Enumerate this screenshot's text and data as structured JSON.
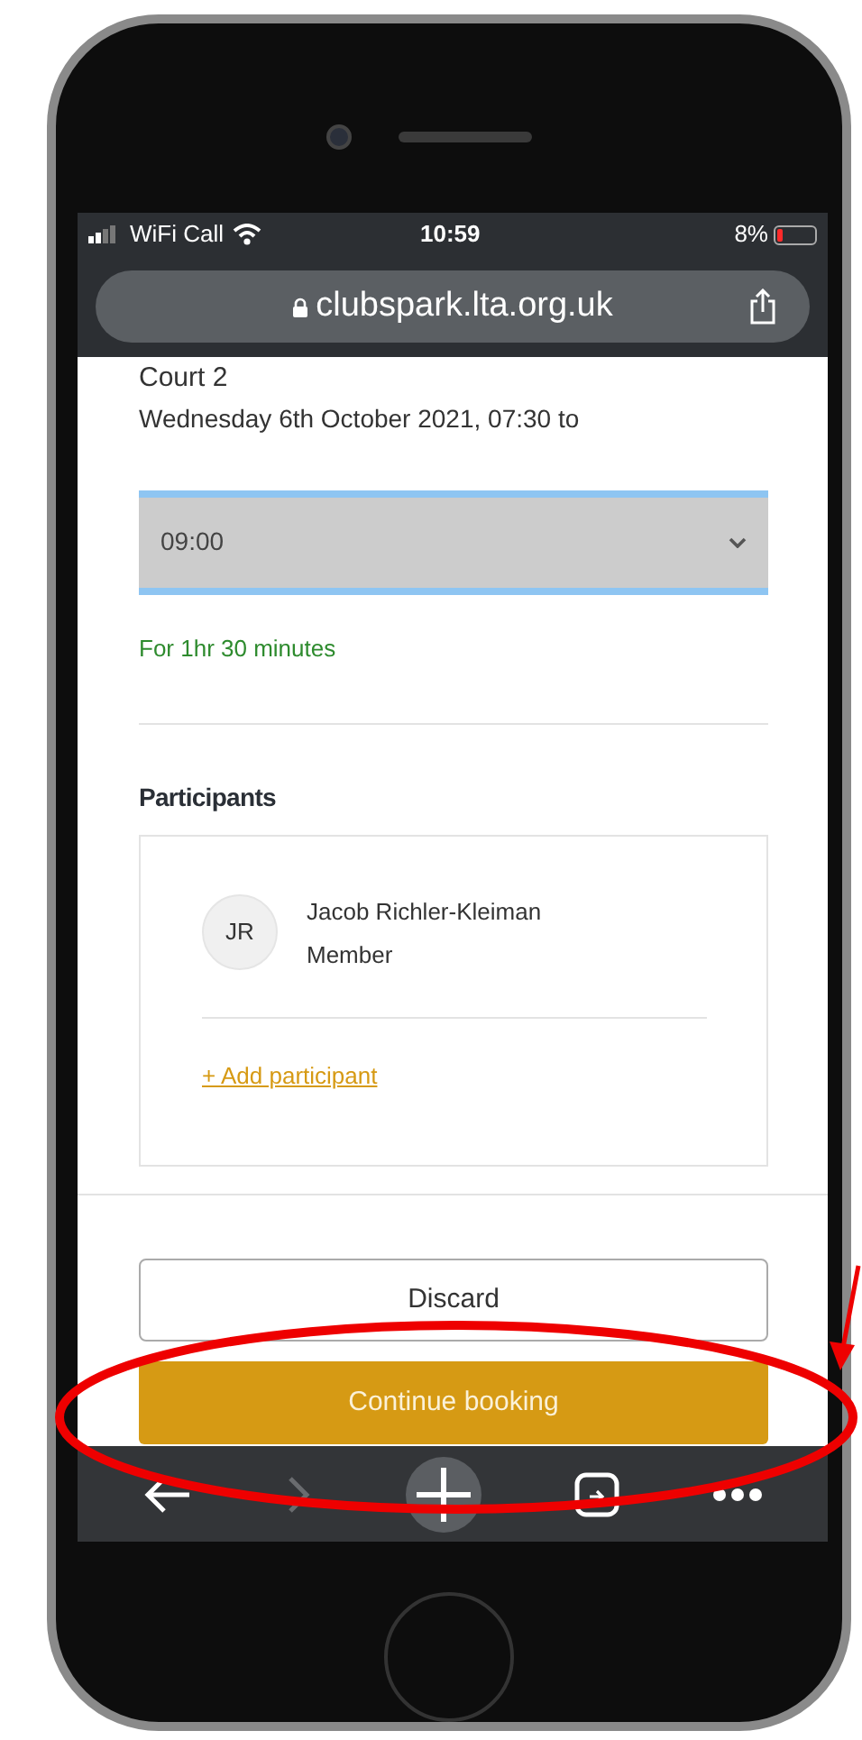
{
  "status_bar": {
    "carrier": "WiFi Call",
    "time": "10:59",
    "battery": "8%"
  },
  "address_bar": {
    "url": "clubspark.lta.org.uk"
  },
  "booking": {
    "court": "Court 2",
    "date_line": "Wednesday 6th October 2021, 07:30 to",
    "end_time": "09:00",
    "duration": "For 1hr 30 minutes"
  },
  "participants": {
    "heading": "Participants",
    "list": [
      {
        "initials": "JR",
        "name": "Jacob Richler-Kleiman",
        "role": "Member"
      }
    ],
    "add_link": "+ Add participant"
  },
  "buttons": [
    {
      "label": "Discard",
      "kind": "outline"
    },
    {
      "label": "Continue booking",
      "kind": "primary"
    }
  ],
  "toolbar": [
    {
      "kind": "back",
      "disabled": false
    },
    {
      "kind": "forward",
      "disabled": true
    },
    {
      "kind": "new-tab",
      "disabled": false
    },
    {
      "kind": "tabs",
      "disabled": false
    },
    {
      "kind": "more",
      "disabled": false
    }
  ]
}
